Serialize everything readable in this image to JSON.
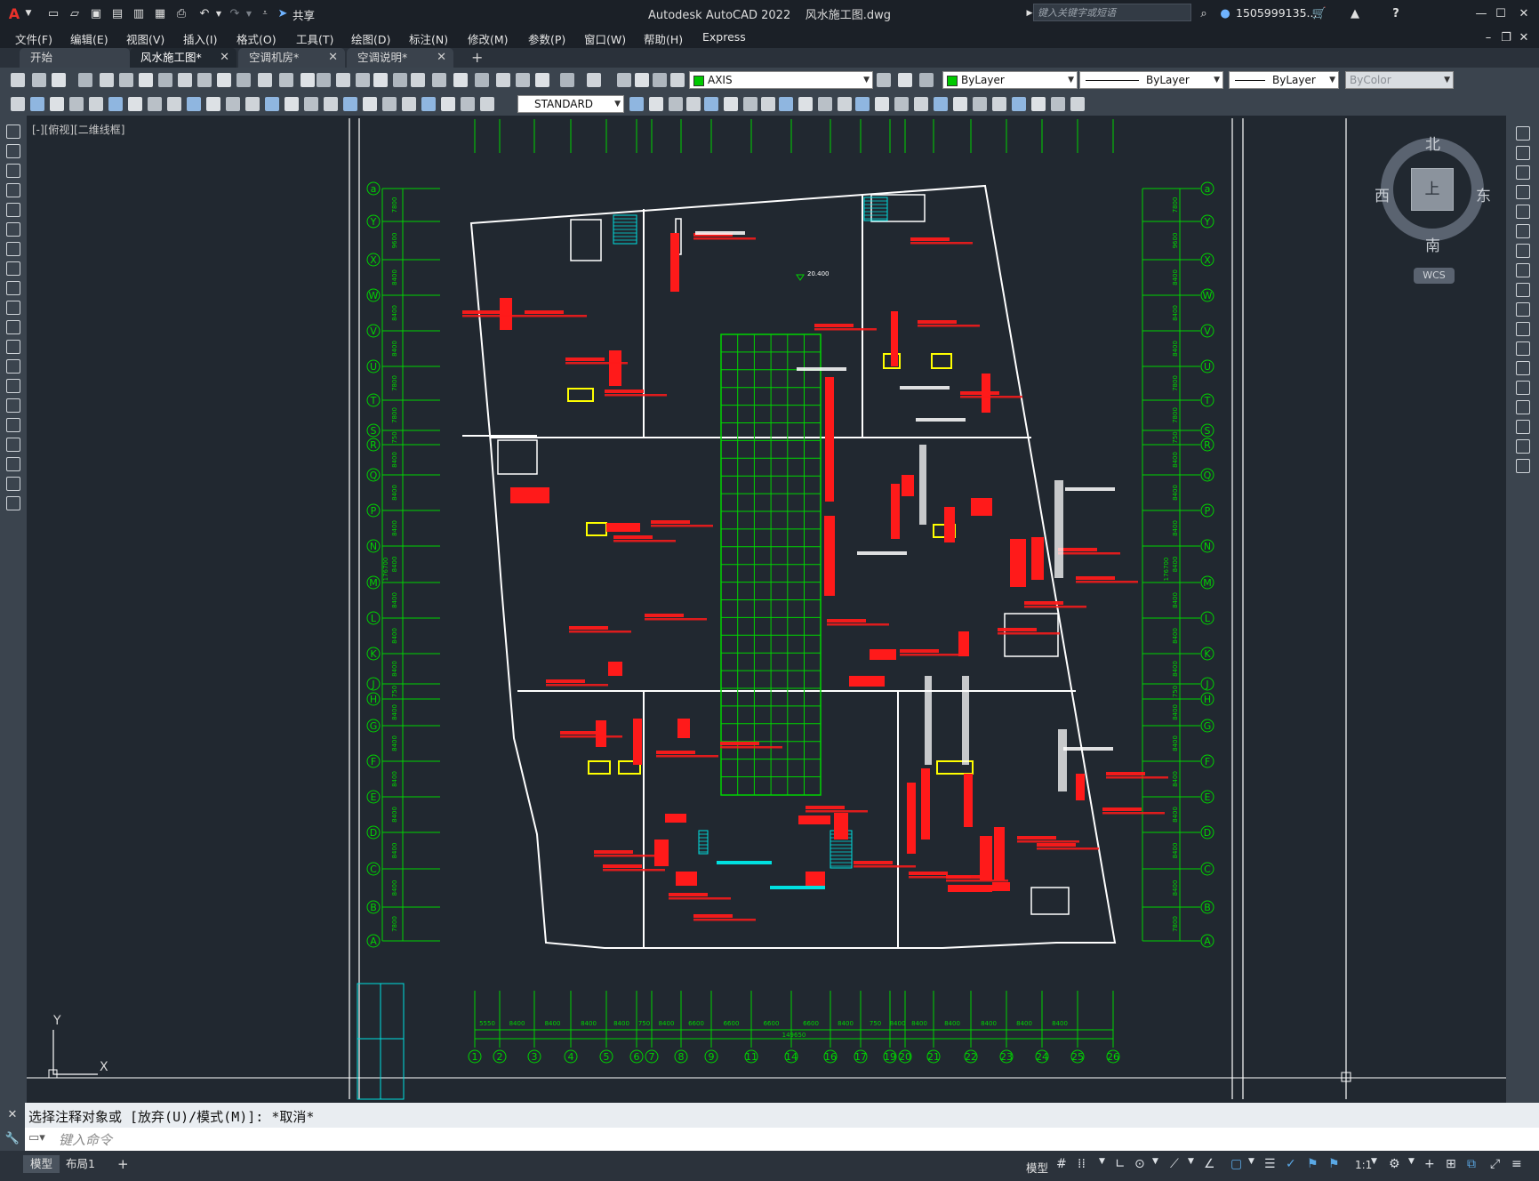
{
  "app": {
    "title": "Autodesk AutoCAD 2022",
    "file": "风水施工图.dwg",
    "logo": "A",
    "share": "共享",
    "search_placeholder": "键入关键字或短语",
    "user": "1505999135...",
    "help": "?"
  },
  "menu": [
    "文件(F)",
    "编辑(E)",
    "视图(V)",
    "插入(I)",
    "格式(O)",
    "工具(T)",
    "绘图(D)",
    "标注(N)",
    "修改(M)",
    "参数(P)",
    "窗口(W)",
    "帮助(H)",
    "Express"
  ],
  "tabs": [
    {
      "label": "开始",
      "active": false,
      "closable": false
    },
    {
      "label": "风水施工图*",
      "active": true,
      "closable": true
    },
    {
      "label": "空调机房*",
      "active": false,
      "closable": true
    },
    {
      "label": "空调说明*",
      "active": false,
      "closable": true
    }
  ],
  "toolbar": {
    "layer": "AXIS",
    "color": "ByLayer",
    "linetype": "ByLayer",
    "lineweight": "ByLayer",
    "plotstyle": "ByColor",
    "textstyle": "STANDARD",
    "layer_color": "#00c800"
  },
  "viewport": {
    "label": "[-][俯视][二维线框]",
    "compass": {
      "n": "北",
      "s": "南",
      "e": "东",
      "w": "西",
      "center": "上"
    },
    "wcs": "WCS",
    "ucs_y": "Y",
    "ucs_x": "X"
  },
  "drawing": {
    "row_labels": [
      "a",
      "Y",
      "X",
      "W",
      "V",
      "U",
      "T",
      "S",
      "R",
      "Q",
      "P",
      "N",
      "M",
      "L",
      "K",
      "J",
      "H",
      "G",
      "F",
      "E",
      "D",
      "C",
      "B",
      "A"
    ],
    "row_dims": [
      "7800",
      "9600",
      "8400",
      "8400",
      "8400",
      "7800",
      "7800",
      "750",
      "8400",
      "8400",
      "8400",
      "8400",
      "8400",
      "8400",
      "8400",
      "750",
      "8400",
      "8400",
      "8400",
      "8400",
      "8400",
      "8400",
      "7800"
    ],
    "col_labels": [
      "1",
      "2",
      "3",
      "4",
      "5",
      "6",
      "7",
      "8",
      "9",
      "11",
      "14",
      "16",
      "17",
      "19",
      "20",
      "21",
      "22",
      "23",
      "24",
      "25",
      "26"
    ],
    "col_dims": [
      "5550",
      "8400",
      "8400",
      "8400",
      "8400",
      "750",
      "8400",
      "6600",
      "6600",
      "6600",
      "6600",
      "8400",
      "750",
      "8400",
      "8400",
      "8400",
      "8400",
      "8400",
      "8400"
    ],
    "total_width": "149650",
    "total_height": "176700",
    "elevation": "20.400"
  },
  "command": {
    "history": "选择注释对象或 [放弃(U)/模式(M)]: *取消*",
    "placeholder": "键入命令"
  },
  "status": {
    "layouts": [
      "模型",
      "布局1"
    ],
    "model_label": "模型",
    "scale": "1:1"
  }
}
